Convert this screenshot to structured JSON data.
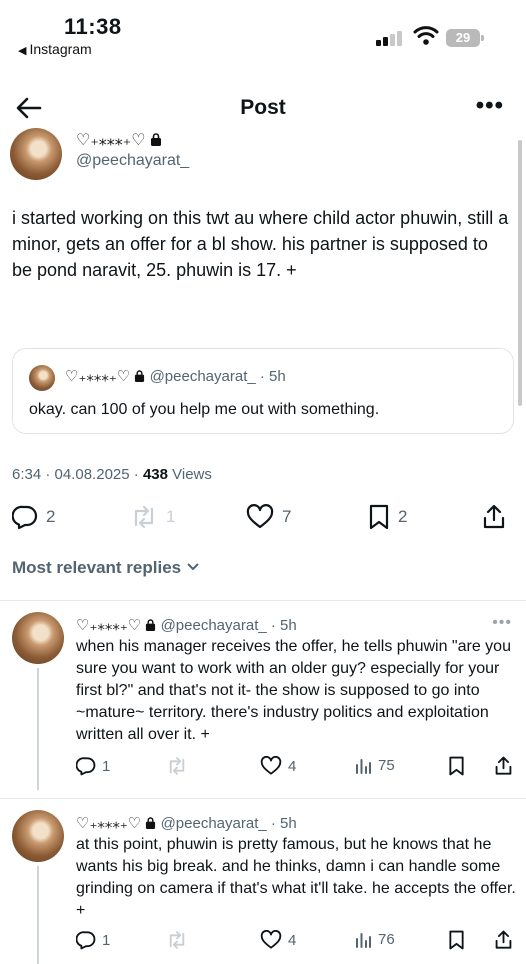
{
  "status": {
    "time": "11:38",
    "back_app": "Instagram",
    "battery": "29"
  },
  "nav": {
    "title": "Post"
  },
  "post": {
    "display_name": "♡₊⁎⁎⁎₊♡",
    "handle": "@peechayarat_",
    "text": "i started working on this twt au where child actor phuwin, still a minor, gets an offer for a bl show. his partner is supposed to be pond naravit, 25.  phuwin is 17. +",
    "quote": {
      "display_name": "♡₊⁎⁎⁎₊♡",
      "handle": "@peechayarat_",
      "time": "· 5h",
      "text": "okay. can 100 of you help me out with something."
    },
    "timestamp": "6:34 · 04.08.2025 · ",
    "views_count": "438",
    "views_label": " Views",
    "stats": {
      "replies": "2",
      "reposts": "1",
      "likes": "7",
      "bookmarks": "2"
    }
  },
  "replies_section": {
    "label": "Most relevant replies"
  },
  "replies": [
    {
      "display_name": "♡₊⁎⁎⁎₊♡",
      "handle": "@peechayarat_",
      "time": "· 5h",
      "text": "when his manager receives the offer, he tells phuwin \"are you sure you want to work with an older guy? especially for your first bl?\" and that's not it- the show is supposed to go into ~mature~ territory. there's industry politics and exploitation written all over it. +",
      "replies": "1",
      "reposts": "",
      "likes": "4",
      "views": "75"
    },
    {
      "display_name": "♡₊⁎⁎⁎₊♡",
      "handle": "@peechayarat_",
      "time": "· 5h",
      "text": "at this point, phuwin is pretty famous, but he knows that he wants his big break. and he thinks, damn i can handle some grinding on camera if that's what it'll take. he accepts the offer. +",
      "replies": "1",
      "reposts": "",
      "likes": "4",
      "views": "76"
    }
  ],
  "colors": {
    "text": "#0f1419",
    "secondary": "#536471",
    "border": "#dfe3e6"
  },
  "icons": [
    "back-arrow-icon",
    "more-icon",
    "lock-icon",
    "reply-icon",
    "repost-icon",
    "like-icon",
    "bookmark-icon",
    "share-icon",
    "views-icon",
    "chevron-down-icon"
  ]
}
